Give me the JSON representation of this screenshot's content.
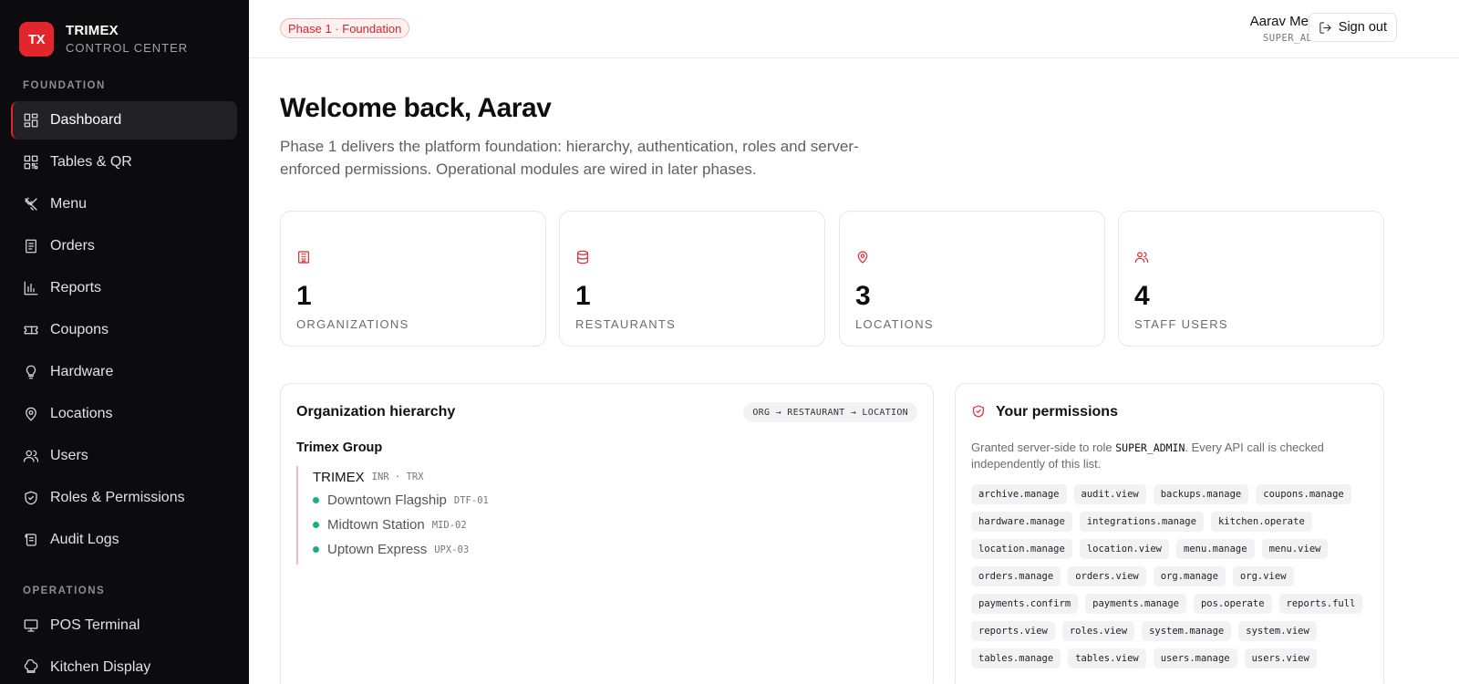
{
  "brand": {
    "logo": "TX",
    "name": "TRIMEX",
    "subtitle": "CONTROL CENTER"
  },
  "sidebar": {
    "sections": [
      {
        "label": "FOUNDATION"
      },
      {
        "label": "OPERATIONS"
      }
    ],
    "items": [
      {
        "label": "Dashboard",
        "icon": "dashboard-icon",
        "active": true
      },
      {
        "label": "Tables & QR",
        "icon": "qr-icon"
      },
      {
        "label": "Menu",
        "icon": "utensils-icon"
      },
      {
        "label": "Orders",
        "icon": "receipt-icon"
      },
      {
        "label": "Reports",
        "icon": "bar-chart-icon"
      },
      {
        "label": "Coupons",
        "icon": "ticket-icon"
      },
      {
        "label": "Hardware",
        "icon": "lightbulb-icon"
      },
      {
        "label": "Locations",
        "icon": "map-pin-icon"
      },
      {
        "label": "Users",
        "icon": "users-icon"
      },
      {
        "label": "Roles & Permissions",
        "icon": "shield-icon"
      },
      {
        "label": "Audit Logs",
        "icon": "scroll-icon"
      },
      {
        "label": "POS Terminal",
        "icon": "monitor-icon"
      },
      {
        "label": "Kitchen Display",
        "icon": "chef-hat-icon"
      }
    ]
  },
  "header": {
    "phase_badge": "Phase 1 · Foundation",
    "user_name": "Aarav Menon",
    "user_role": "SUPER_ADMIN",
    "signout_label": "Sign out"
  },
  "main": {
    "welcome": "Welcome back, Aarav",
    "intro": "Phase 1 delivers the platform foundation: hierarchy, authentication, roles and server-enforced permissions. Operational modules are wired in later phases."
  },
  "stats": [
    {
      "value": "1",
      "label": "ORGANIZATIONS",
      "icon": "building-icon"
    },
    {
      "value": "1",
      "label": "RESTAURANTS",
      "icon": "database-icon"
    },
    {
      "value": "3",
      "label": "LOCATIONS",
      "icon": "map-pin-icon"
    },
    {
      "value": "4",
      "label": "STAFF USERS",
      "icon": "users-icon"
    }
  ],
  "hierarchy": {
    "title": "Organization hierarchy",
    "path_chip": "ORG → RESTAURANT → LOCATION",
    "org_name": "Trimex Group",
    "restaurant": {
      "name": "TRIMEX",
      "meta": "INR · TRX"
    },
    "locations": [
      {
        "name": "Downtown Flagship",
        "code": "DTF-01"
      },
      {
        "name": "Midtown Station",
        "code": "MID-02"
      },
      {
        "name": "Uptown Express",
        "code": "UPX-03"
      }
    ]
  },
  "permissions": {
    "title": "Your permissions",
    "desc_before": "Granted server-side to role ",
    "desc_role": "SUPER_ADMIN",
    "desc_after": ". Every API call is checked independently of this list.",
    "items": [
      "archive.manage",
      "audit.view",
      "backups.manage",
      "coupons.manage",
      "hardware.manage",
      "integrations.manage",
      "kitchen.operate",
      "location.manage",
      "location.view",
      "menu.manage",
      "menu.view",
      "orders.manage",
      "orders.view",
      "org.manage",
      "org.view",
      "payments.confirm",
      "payments.manage",
      "pos.operate",
      "reports.full",
      "reports.view",
      "roles.view",
      "system.manage",
      "system.view",
      "tables.manage",
      "tables.view",
      "users.manage",
      "users.view"
    ]
  },
  "colors": {
    "accent": "#e3262b",
    "sidebar_bg": "#0c0c0e",
    "status_dot": "#15b37a"
  }
}
